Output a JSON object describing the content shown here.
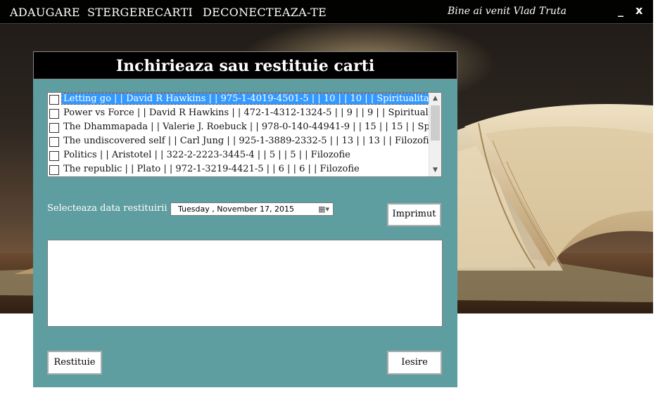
{
  "menu": {
    "items": [
      "ADAUGARE",
      "STERGERE",
      "CARTI",
      "DECONECTEAZA-TE"
    ],
    "welcome": "Bine ai venit Vlad Truta",
    "minimize": "_",
    "close": "x"
  },
  "dialog": {
    "title": "Inchirieaza sau restituie carti",
    "books": [
      "Letting go | | David R Hawkins | | 975-1-4019-4501-5 | | 10 | | 10 | | Spiritualitate",
      "Power vs Force | | David R Hawkins  | | 472-1-4312-1324-5 | | 9 | | 9 | | Spiritualitate",
      "The Dhammapada | | Valerie J. Roebuck | | 978-0-140-44941-9 | | 15 | | 15 | | Spiritualitate",
      "The undiscovered self | | Carl Jung | | 925-1-3889-2332-5 | | 13 | | 13 | | Filozofie, Spiritualitate",
      "Politics | | Aristotel | | 322-2-2223-3445-4 | | 5 | | 5 | | Filozofie",
      "The republic | | Plato | | 972-1-3219-4421-5 | | 6 | | 6 | | Filozofie"
    ],
    "selected_index": 0,
    "date_label": "Selecteaza data restituirii",
    "date_value": "Tuesday   ,  November  17, 2015",
    "print_button": "Imprimut",
    "return_button": "Restituie",
    "exit_button": "Iesire",
    "notes": ""
  }
}
